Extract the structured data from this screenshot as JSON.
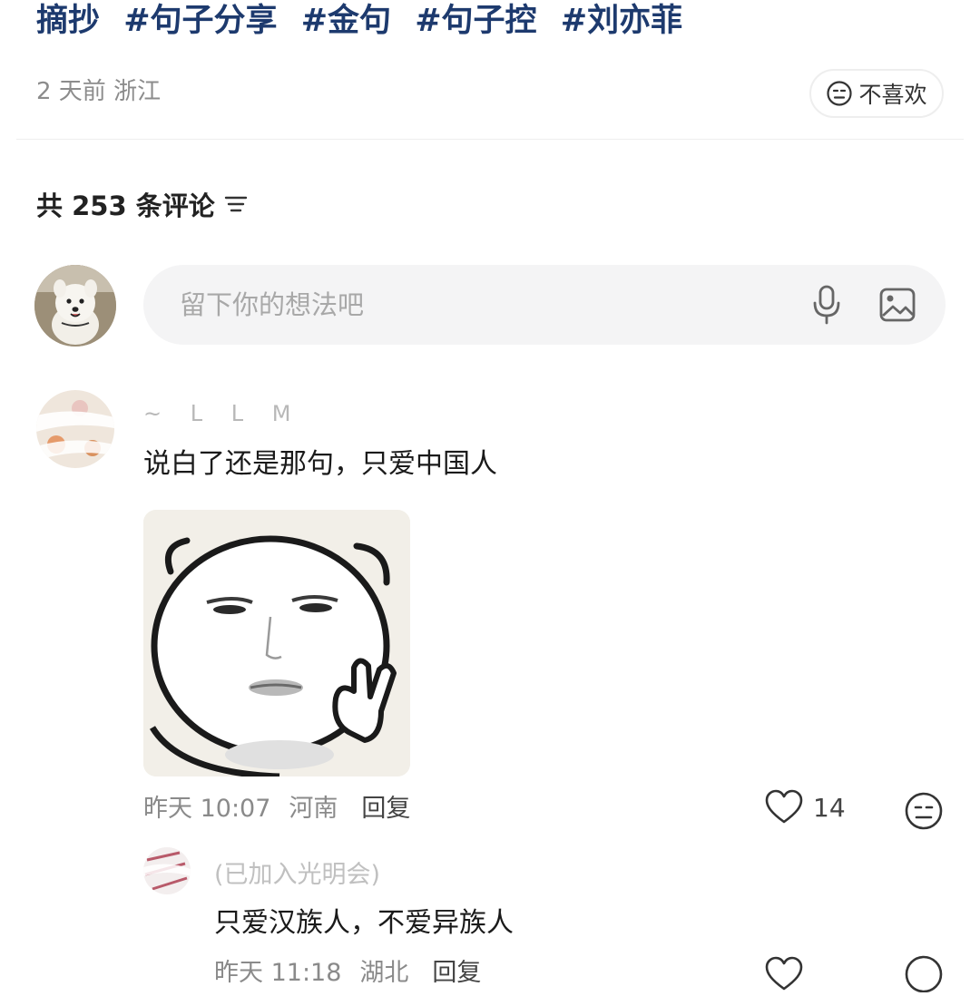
{
  "post": {
    "tags": [
      "摘抄",
      "#句子分享",
      "#金句",
      "#句子控",
      "#刘亦菲"
    ],
    "time": "2 天前",
    "location": "浙江",
    "dislike_label": "不喜欢"
  },
  "comments_header": {
    "count_label": "共 253 条评论"
  },
  "comment_input": {
    "placeholder": "留下你的想法吧"
  },
  "comments": [
    {
      "username": "~ ᒪ ᒪ M",
      "text": "说白了还是那句，只爱中国人",
      "time": "昨天 10:07",
      "location": "河南",
      "reply_label": "回复",
      "likes": "14"
    }
  ],
  "replies": [
    {
      "username": "(已加入光明会)",
      "text": "只爱汉族人，不爱异族人",
      "time": "昨天 11:18",
      "location": "湖北",
      "reply_label": "回复"
    }
  ],
  "colors": {
    "tag": "#1d3a6e",
    "muted": "#8a8a8a",
    "input_bg": "#f4f4f5"
  }
}
